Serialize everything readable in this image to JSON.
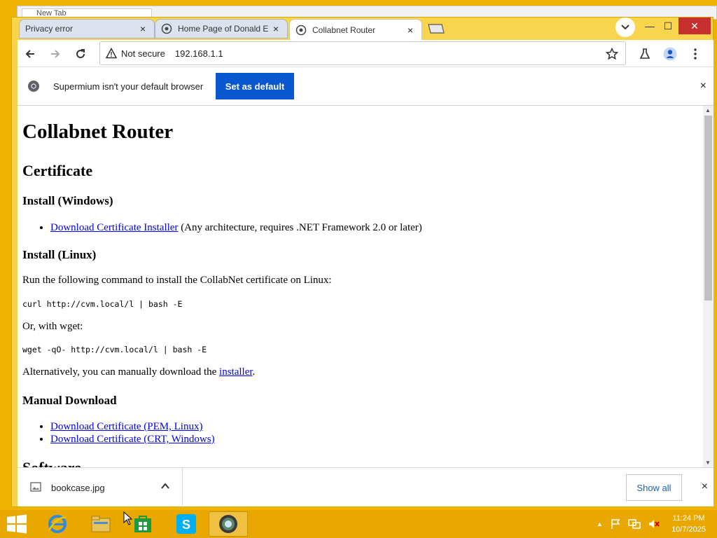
{
  "background_tab": {
    "title": "New Tab"
  },
  "tabs": [
    {
      "title": "Privacy error",
      "close": "×"
    },
    {
      "title": "Home Page of Donald E",
      "close": "×"
    },
    {
      "title": "Collabnet Router",
      "close": "×"
    }
  ],
  "window_controls": {
    "minimize": "—",
    "maximize": "☐",
    "close": "✕"
  },
  "toolbar": {
    "security_label": "Not secure",
    "url": "192.168.1.1"
  },
  "infobar": {
    "message": "Supermium isn't your default browser",
    "button": "Set as default",
    "close": "×"
  },
  "page": {
    "h1": "Collabnet Router",
    "certificate_heading": "Certificate",
    "install_windows_heading": "Install (Windows)",
    "windows_link": "Download Certificate Installer",
    "windows_note": " (Any architecture, requires .NET Framework 2.0 or later)",
    "install_linux_heading": "Install (Linux)",
    "linux_intro": "Run the following command to install the CollabNet certificate on Linux:",
    "curl_cmd": "curl http://cvm.local/l | bash -E",
    "wget_intro": "Or, with wget:",
    "wget_cmd": "wget -qO- http://cvm.local/l | bash -E",
    "manual_prefix": "Alternatively, you can manually download the ",
    "manual_link": "installer",
    "manual_suffix": ".",
    "manual_heading": "Manual Download",
    "pem_link": "Download Certificate (PEM, Linux)",
    "crt_link": "Download Certificate (CRT, Windows)",
    "software_heading": "Software"
  },
  "download_bar": {
    "file_name": "bookcase.jpg",
    "show_all": "Show all",
    "close": "×"
  },
  "taskbar": {
    "time": "11:24 PM",
    "date": "10/7/2025"
  }
}
